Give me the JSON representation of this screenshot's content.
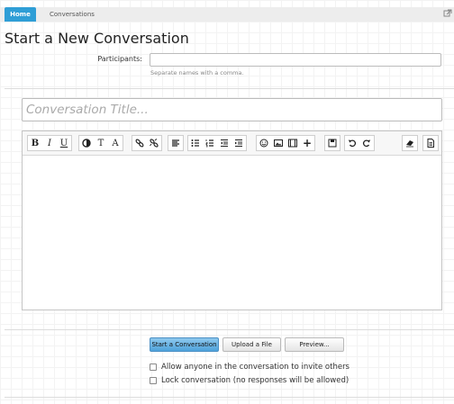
{
  "nav": {
    "home_label": "Home",
    "conversations_label": "Conversations",
    "corner_icon": "external-link-icon"
  },
  "page": {
    "title": "Start a New Conversation"
  },
  "participants": {
    "label": "Participants:",
    "value": "",
    "hint": "Separate names with a comma."
  },
  "conversation_title": {
    "placeholder": "Conversation Title..."
  },
  "toolbar": {
    "groups": [
      [
        "bold-icon",
        "italic-icon",
        "underline-icon"
      ],
      [
        "text-color-icon",
        "font-size-icon",
        "font-family-icon"
      ],
      [
        "link-icon",
        "unlink-icon"
      ],
      [
        "align-icon"
      ],
      [
        "bullet-list-icon",
        "numbered-list-icon",
        "outdent-icon",
        "indent-icon"
      ],
      [
        "smilie-icon",
        "image-icon",
        "media-icon",
        "insert-more-icon"
      ],
      [
        "save-draft-icon"
      ],
      [
        "undo-icon",
        "redo-icon"
      ],
      [
        "remove-format-icon"
      ],
      [
        "bbcode-toggle-icon"
      ]
    ],
    "glyphs": {
      "bold": "B",
      "italic": "I",
      "underline": "U",
      "font_size": "T",
      "font_family": "A",
      "insert_more": "+"
    }
  },
  "buttons": {
    "start": "Start a Conversation",
    "upload": "Upload a File",
    "preview": "Preview..."
  },
  "options": {
    "allow_invite": {
      "label": "Allow anyone in the conversation to invite others",
      "checked": false
    },
    "lock": {
      "label": "Lock conversation (no responses will be allowed)",
      "checked": false
    }
  },
  "colors": {
    "accent": "#2f9ed6",
    "primary_button": "#4fa3db"
  }
}
